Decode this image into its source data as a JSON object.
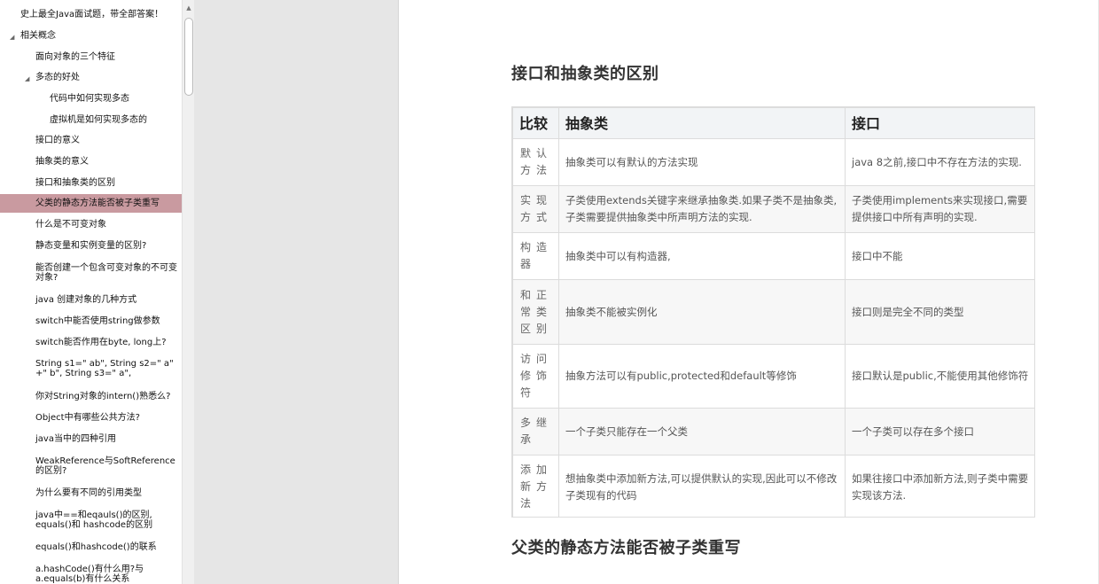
{
  "nav": {
    "items": [
      {
        "label": "史上最全Java面试题，带全部答案！",
        "level": 0,
        "arrow": "",
        "selected": false
      },
      {
        "label": "相关概念",
        "level": 0,
        "arrow": "◢",
        "selected": false
      },
      {
        "label": "面向对象的三个特征",
        "level": 1,
        "arrow": "",
        "selected": false
      },
      {
        "label": "多态的好处",
        "level": 1,
        "arrow": "◢",
        "selected": false
      },
      {
        "label": "代码中如何实现多态",
        "level": 2,
        "arrow": "",
        "selected": false
      },
      {
        "label": "虚拟机是如何实现多态的",
        "level": 2,
        "arrow": "",
        "selected": false
      },
      {
        "label": "接口的意义",
        "level": 1,
        "arrow": "",
        "selected": false
      },
      {
        "label": "抽象类的意义",
        "level": 1,
        "arrow": "",
        "selected": false
      },
      {
        "label": "接口和抽象类的区别",
        "level": 1,
        "arrow": "",
        "selected": false
      },
      {
        "label": "父类的静态方法能否被子类重写",
        "level": 1,
        "arrow": "",
        "selected": true
      },
      {
        "label": "什么是不可变对象",
        "level": 1,
        "arrow": "",
        "selected": false
      },
      {
        "label": "静态变量和实例变量的区别?",
        "level": 1,
        "arrow": "",
        "selected": false
      },
      {
        "label": "能否创建一个包含可变对象的不可变对象?",
        "level": 1,
        "arrow": "",
        "selected": false
      },
      {
        "label": "java 创建对象的几种方式",
        "level": 1,
        "arrow": "",
        "selected": false
      },
      {
        "label": "switch中能否使用string做参数",
        "level": 1,
        "arrow": "",
        "selected": false
      },
      {
        "label": "switch能否作用在byte, long上?",
        "level": 1,
        "arrow": "",
        "selected": false
      },
      {
        "label": "String s1=\" ab\", String s2=\" a\" +\" b\", String s3=\" a\",",
        "level": 1,
        "arrow": "",
        "selected": false
      },
      {
        "label": "你对String对象的intern()熟悉么?",
        "level": 1,
        "arrow": "",
        "selected": false
      },
      {
        "label": "Object中有哪些公共方法?",
        "level": 1,
        "arrow": "",
        "selected": false
      },
      {
        "label": "java当中的四种引用",
        "level": 1,
        "arrow": "",
        "selected": false
      },
      {
        "label": "WeakReference与SoftReference的区别?",
        "level": 1,
        "arrow": "",
        "selected": false
      },
      {
        "label": "为什么要有不同的引用类型",
        "level": 1,
        "arrow": "",
        "selected": false
      },
      {
        "label": "java中==和eqauls()的区别, equals()和 hashcode的区别",
        "level": 1,
        "arrow": "",
        "selected": false
      },
      {
        "label": "equals()和hashcode()的联系",
        "level": 1,
        "arrow": "",
        "selected": false
      },
      {
        "label": "a.hashCode()有什么用?与a.equals(b)有什么关系",
        "level": 1,
        "arrow": "",
        "selected": false
      }
    ]
  },
  "doc": {
    "heading1": "接口和抽象类的区别",
    "heading2": "父类的静态方法能否被子类重写",
    "table": {
      "headers": [
        "比较",
        "抽象类",
        "接口"
      ],
      "rows": [
        [
          "默认方法",
          "抽象类可以有默认的方法实现",
          "java 8之前,接口中不存在方法的实现."
        ],
        [
          "实现方式",
          "子类使用extends关键字来继承抽象类.如果子类不是抽象类,子类需要提供抽象类中所声明方法的实现.",
          "子类使用implements来实现接口,需要提供接口中所有声明的实现."
        ],
        [
          "构造器",
          "抽象类中可以有构造器,",
          "接口中不能"
        ],
        [
          "和正常类区别",
          "抽象类不能被实例化",
          "接口则是完全不同的类型"
        ],
        [
          "访问修饰符",
          "抽象方法可以有public,protected和default等修饰",
          "接口默认是public,不能使用其他修饰符"
        ],
        [
          "多继承",
          "一个子类只能存在一个父类",
          "一个子类可以存在多个接口"
        ],
        [
          "添加新方法",
          "想抽象类中添加新方法,可以提供默认的实现,因此可以不修改子类现有的代码",
          "如果往接口中添加新方法,则子类中需要实现该方法."
        ]
      ]
    }
  },
  "icons": {
    "scroll_up": "triangle-up-icon",
    "expand": "triangle-expanded-icon"
  }
}
